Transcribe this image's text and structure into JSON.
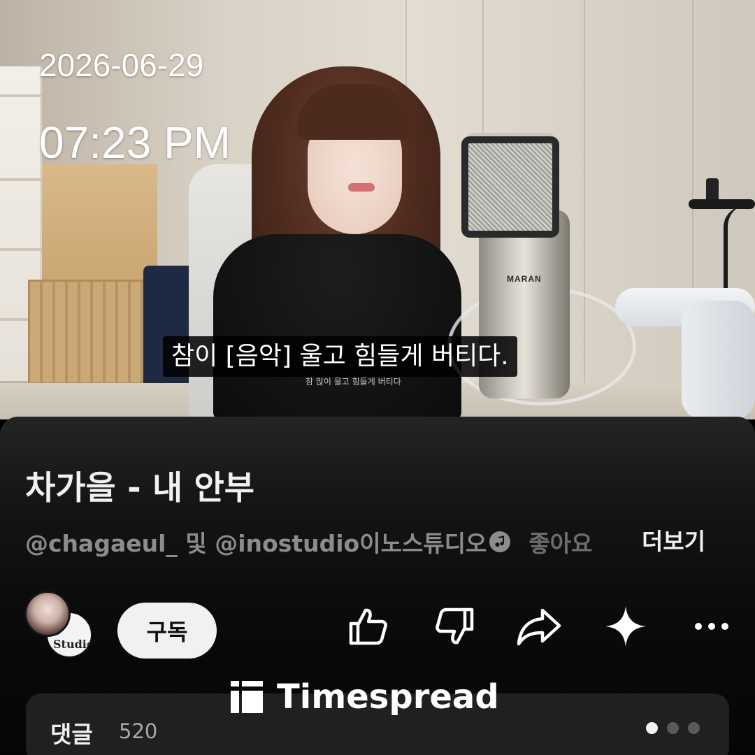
{
  "overlay": {
    "date": "2026-06-29",
    "time": "07:23 PM"
  },
  "video": {
    "caption": "참이 [음악] 울고 힘들게 버티다.",
    "burned_in_caption": "참 많이 울고 힘들게 버티다",
    "mic_brand": "MARAN"
  },
  "info": {
    "title": "차가을 - 내 안부",
    "creators": "@chagaeul_ 및 @inostudio이노스튜디오",
    "likes_faded": "좋아요",
    "more_label": "더보기",
    "avatar_back_text": "o Studio."
  },
  "actions": {
    "subscribe_label": "구독",
    "icons": [
      "thumbs-up-icon",
      "thumbs-down-icon",
      "share-icon",
      "sparkle-icon",
      "more-icon"
    ]
  },
  "watermark": {
    "text": "Timespread"
  },
  "comments": {
    "label": "댓글",
    "count": "520",
    "pager_active": 1,
    "pager_total": 3
  },
  "colors": {
    "sheet_bg": "#0f0f0f",
    "primary_text": "#f1f1f1",
    "secondary_text": "#8c8c8c",
    "button_bg": "#f1f1f1"
  }
}
